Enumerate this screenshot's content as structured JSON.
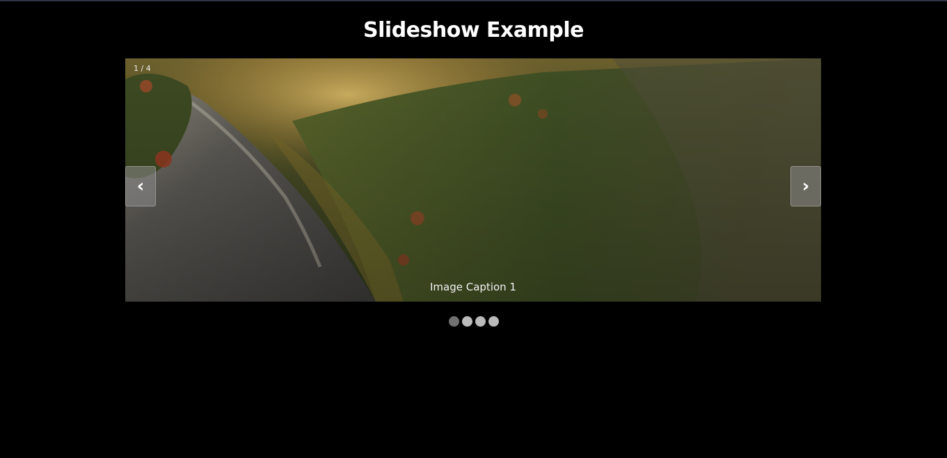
{
  "page": {
    "title": "Slideshow Example"
  },
  "slideshow": {
    "counter": "1 / 4",
    "caption": "Image Caption 1",
    "prev_label": "‹",
    "next_label": "›",
    "current_slide": 1,
    "total_slides": 4,
    "dots": [
      {
        "active": true
      },
      {
        "active": false
      },
      {
        "active": false
      },
      {
        "active": false
      }
    ]
  },
  "colors": {
    "background": "#000000",
    "dot_active": "#717171",
    "dot_inactive": "#bbbbbb",
    "title": "#ffffff"
  }
}
